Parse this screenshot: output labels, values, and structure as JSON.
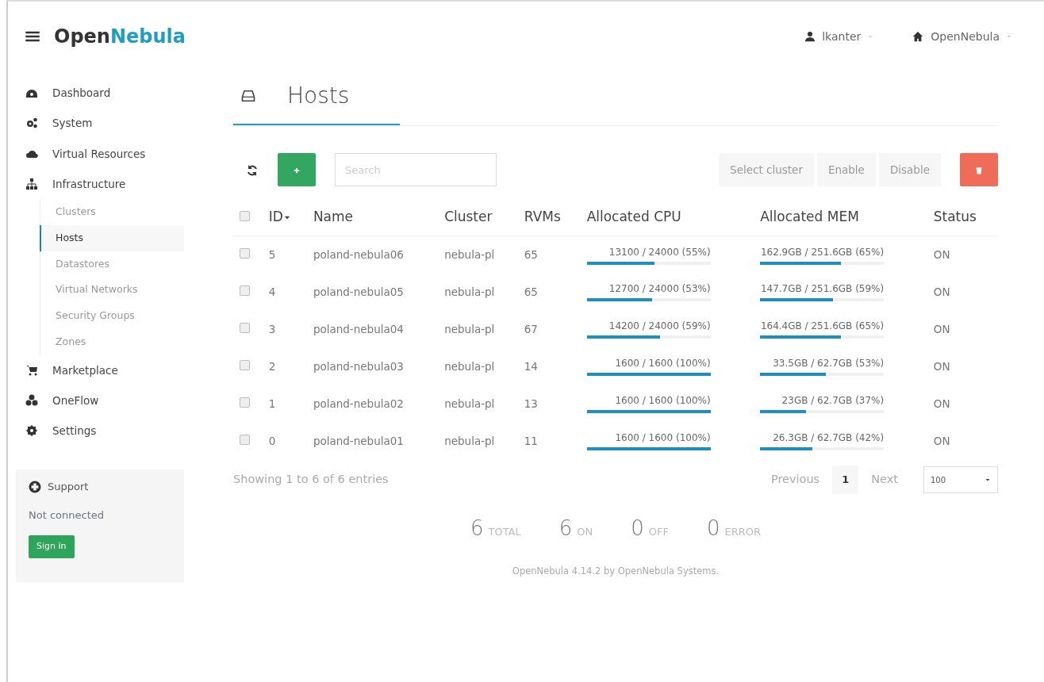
{
  "header": {
    "logo": {
      "dark": "Open",
      "accent": "Nebula"
    },
    "user_menu": "lkanter",
    "zone_menu": "OpenNebula"
  },
  "sidebar": {
    "items": [
      {
        "label": "Dashboard",
        "selected": false
      },
      {
        "label": "System",
        "selected": false
      },
      {
        "label": "Virtual Resources",
        "selected": false
      },
      {
        "label": "Infrastructure",
        "selected": false,
        "children": [
          {
            "label": "Clusters",
            "selected": false
          },
          {
            "label": "Hosts",
            "selected": true
          },
          {
            "label": "Datastores",
            "selected": false
          },
          {
            "label": "Virtual Networks",
            "selected": false
          },
          {
            "label": "Security Groups",
            "selected": false
          },
          {
            "label": "Zones",
            "selected": false
          }
        ]
      },
      {
        "label": "Marketplace",
        "selected": false
      },
      {
        "label": "OneFlow",
        "selected": false
      },
      {
        "label": "Settings",
        "selected": false
      }
    ],
    "support": {
      "title": "Support",
      "status": "Not connected",
      "button": "Sign in"
    }
  },
  "page": {
    "title": "Hosts",
    "toolbar": {
      "search": {
        "placeholder": "Search"
      },
      "buttons": [
        "Select cluster",
        "Enable",
        "Disable"
      ]
    },
    "table": {
      "columns": [
        "ID",
        "Name",
        "Cluster",
        "RVMs",
        "Allocated CPU",
        "Allocated MEM",
        "Status"
      ],
      "header_checked": false,
      "rows": [
        {
          "checked": false,
          "id": "5",
          "name": "poland-nebula06",
          "cluster": "nebula-pl",
          "rvms": "65",
          "cpu": {
            "reading": "13100 / 24000 (55%)",
            "level": 0.55
          },
          "mem": {
            "reading": "162.9GB / 251.6GB (65%)",
            "level": 0.65
          },
          "status": "ON"
        },
        {
          "checked": false,
          "id": "4",
          "name": "poland-nebula05",
          "cluster": "nebula-pl",
          "rvms": "65",
          "cpu": {
            "reading": "12700 / 24000 (53%)",
            "level": 0.53
          },
          "mem": {
            "reading": "147.7GB / 251.6GB (59%)",
            "level": 0.59
          },
          "status": "ON"
        },
        {
          "checked": false,
          "id": "3",
          "name": "poland-nebula04",
          "cluster": "nebula-pl",
          "rvms": "67",
          "cpu": {
            "reading": "14200 / 24000 (59%)",
            "level": 0.59
          },
          "mem": {
            "reading": "164.4GB / 251.6GB (65%)",
            "level": 0.65
          },
          "status": "ON"
        },
        {
          "checked": false,
          "id": "2",
          "name": "poland-nebula03",
          "cluster": "nebula-pl",
          "rvms": "14",
          "cpu": {
            "reading": "1600 / 1600 (100%)",
            "level": 1
          },
          "mem": {
            "reading": "33.5GB / 62.7GB (53%)",
            "level": 0.53
          },
          "status": "ON"
        },
        {
          "checked": false,
          "id": "1",
          "name": "poland-nebula02",
          "cluster": "nebula-pl",
          "rvms": "13",
          "cpu": {
            "reading": "1600 / 1600 (100%)",
            "level": 1
          },
          "mem": {
            "reading": "23GB / 62.7GB (37%)",
            "level": 0.37
          },
          "status": "ON"
        },
        {
          "checked": false,
          "id": "0",
          "name": "poland-nebula01",
          "cluster": "nebula-pl",
          "rvms": "11",
          "cpu": {
            "reading": "1600 / 1600 (100%)",
            "level": 1
          },
          "mem": {
            "reading": "26.3GB / 62.7GB (42%)",
            "level": 0.42
          },
          "status": "ON"
        }
      ]
    },
    "info": "Showing 1 to 6 of 6 entries",
    "pagination": {
      "previous": "Previous",
      "pages": [
        {
          "label": "1",
          "selected": true
        }
      ],
      "next": "Next",
      "page_size": "100"
    },
    "stats": [
      {
        "value": "6",
        "label": "TOTAL"
      },
      {
        "value": "6",
        "label": "ON"
      },
      {
        "value": "0",
        "label": "OFF"
      },
      {
        "value": "0",
        "label": "ERROR"
      }
    ],
    "footer": "OpenNebula 4.14.2 by OpenNebula Systems."
  }
}
